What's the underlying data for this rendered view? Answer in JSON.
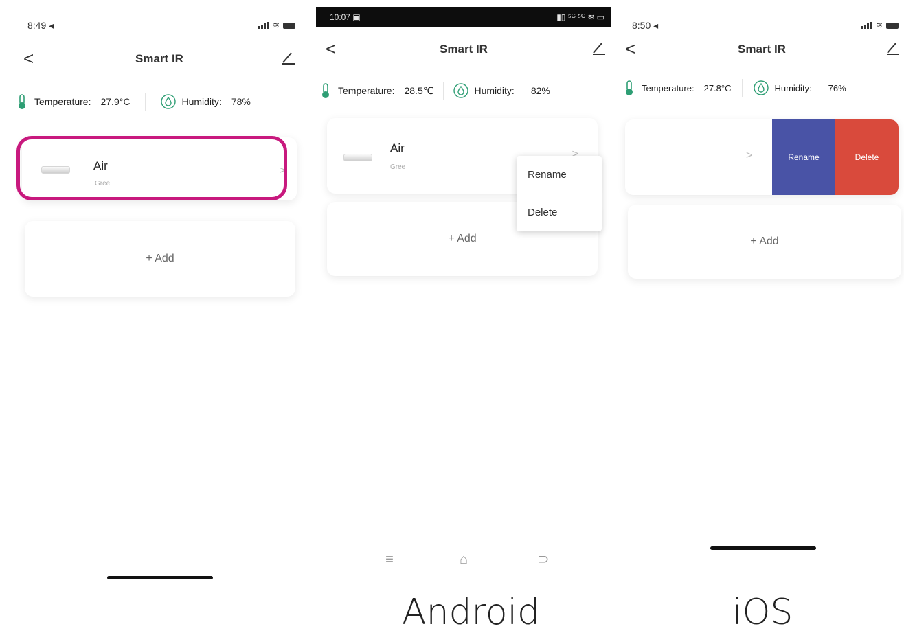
{
  "colors": {
    "highlight": "#c8197e",
    "rename": "#4953a6",
    "delete": "#d94a3c",
    "sensor_icon": "#2e9e74"
  },
  "screens": [
    {
      "status": {
        "time": "8:49 ◂"
      },
      "nav": {
        "back": "<",
        "title": "Smart IR"
      },
      "sensors": {
        "temp_label": "Temperature:",
        "temp_value": "27.9°C",
        "hum_label": "Humidity:",
        "hum_value": "78%"
      },
      "device": {
        "name": "Air",
        "brand": "Gree",
        "chevron": ">"
      },
      "add": "+ Add"
    },
    {
      "status": {
        "time": "10:07",
        "right": "▮▯ ⁵ᴳ ⁵ᴳ ≋ ▭"
      },
      "nav": {
        "back": "<",
        "title": "Smart IR"
      },
      "sensors": {
        "temp_label": "Temperature:",
        "temp_value": "28.5℃",
        "hum_label": "Humidity:",
        "hum_value": "82%"
      },
      "device": {
        "name": "Air",
        "brand": "Gree",
        "chevron": ">"
      },
      "menu": {
        "rename": "Rename",
        "delete": "Delete"
      },
      "add": "+ Add",
      "nav_buttons": {
        "menu": "≡",
        "home": "⌂",
        "back": "⊃"
      }
    },
    {
      "status": {
        "time": "8:50 ◂"
      },
      "nav": {
        "back": "<",
        "title": "Smart IR"
      },
      "sensors": {
        "temp_label": "Temperature:",
        "temp_value": "27.8°C",
        "hum_label": "Humidity:",
        "hum_value": "76%"
      },
      "device": {
        "chevron": ">"
      },
      "swipe": {
        "rename": "Rename",
        "delete": "Delete"
      },
      "add": "+ Add"
    }
  ],
  "captions": {
    "android": "Android",
    "ios": "iOS"
  }
}
